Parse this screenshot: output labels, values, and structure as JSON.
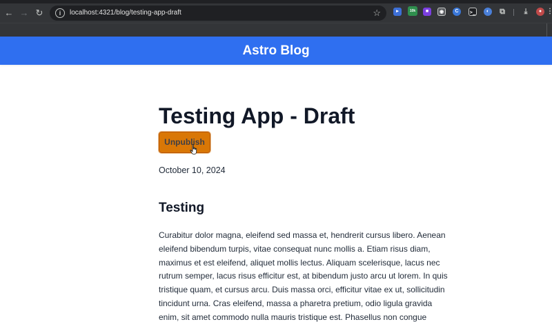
{
  "browser": {
    "url": "localhost:4321/blog/testing-app-draft",
    "extensions": [
      {
        "name": "video-extension-icon",
        "glyph": "▸"
      },
      {
        "name": "speed-extension-icon",
        "glyph": "10k"
      },
      {
        "name": "purple-extension-icon",
        "glyph": "■"
      },
      {
        "name": "eye-extension-icon",
        "glyph": "◉"
      },
      {
        "name": "c-extension-icon",
        "glyph": "C"
      },
      {
        "name": "terminal-extension-icon",
        "glyph": ">_"
      },
      {
        "name": "globe-extension-icon",
        "glyph": "◐"
      },
      {
        "name": "puzzle-extensions-icon",
        "glyph": "⧉"
      },
      {
        "name": "download-icon",
        "glyph": "⤓"
      },
      {
        "name": "profile-avatar",
        "glyph": "●"
      },
      {
        "name": "menu-icon",
        "glyph": "⋮"
      }
    ]
  },
  "site": {
    "title": "Astro Blog",
    "header_color": "#2f6ff0"
  },
  "post": {
    "title": "Testing App - Draft",
    "unpublish_label": "Unpublish",
    "button_color": "#d97706",
    "date": "October 10, 2024",
    "section_heading": "Testing",
    "body": "Curabitur dolor magna, eleifend sed massa et, hendrerit cursus libero. Aenean eleifend bibendum turpis, vitae consequat nunc mollis a. Etiam risus diam, maximus et est eleifend, aliquet mollis lectus. Aliquam scelerisque, lacus nec rutrum semper, lacus risus efficitur est, at bibendum justo arcu ut lorem. In quis tristique quam, et cursus arcu. Duis massa orci, efficitur vitae ex ut, sollicitudin tincidunt urna. Cras eleifend, massa a pharetra pretium, odio ligula gravida enim, sit amet commodo nulla mauris tristique est. Phasellus non congue diam. Mauris scelerisque lobortis"
  }
}
